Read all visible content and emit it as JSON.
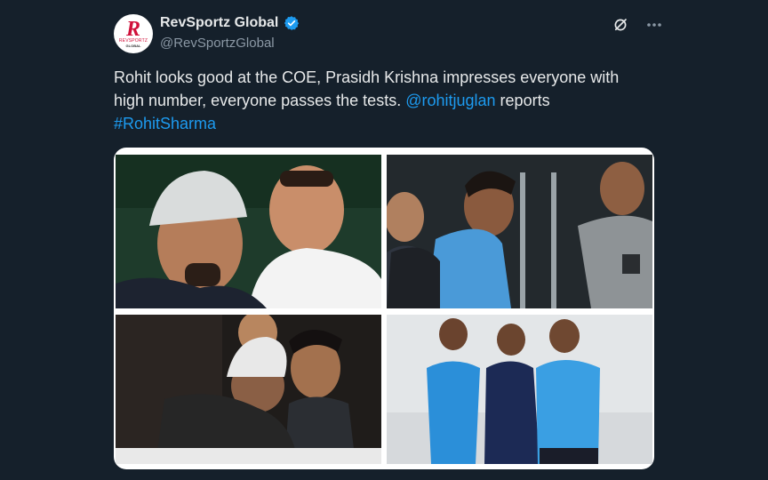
{
  "account": {
    "display_name": "RevSportz Global",
    "handle": "@RevSportzGlobal",
    "avatar_logo": {
      "mark": "R",
      "tagline": "REVSPORTZ",
      "sub": "GLOBAL"
    },
    "verified": true
  },
  "icons": {
    "grok": "grok-icon",
    "more": "more-icon",
    "verified": "verified-badge-icon"
  },
  "tweet": {
    "text_plain": "Rohit looks good at the COE, Prasidh Krishna impresses everyone with high number, everyone passes the tests. ",
    "mention": "@rohitjuglan",
    "text_after": " reports",
    "hashtag": "#RohitSharma"
  },
  "media": {
    "photo_count": 4
  },
  "colors": {
    "background": "#15202b",
    "link": "#1d9bf0",
    "verified": "#1d9bf0",
    "text": "#e7e9ea",
    "muted": "#8b98a5"
  }
}
